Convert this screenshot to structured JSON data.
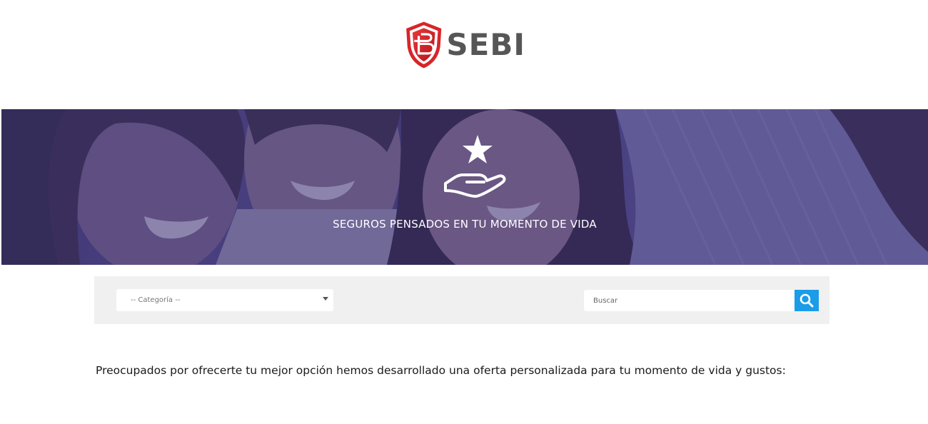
{
  "brand": {
    "name": "SEBI",
    "logo_monogram": "B",
    "colors": {
      "shield_red": "#d8252a",
      "text_gray": "#565656"
    }
  },
  "hero": {
    "title": "SEGUROS PENSADOS EN TU MOMENTO DE VIDA",
    "icon": "hand-star-icon",
    "overlay_color": "#4c4480"
  },
  "filters": {
    "category_value": "-- Categoría --",
    "search_placeholder": "Buscar",
    "search_button_icon": "search-icon",
    "accent_color": "#1a9ce8"
  },
  "content": {
    "intro": "Preocupados por ofrecerte tu mejor opción hemos desarrollado una oferta personalizada para tu momento de vida y gustos:"
  }
}
